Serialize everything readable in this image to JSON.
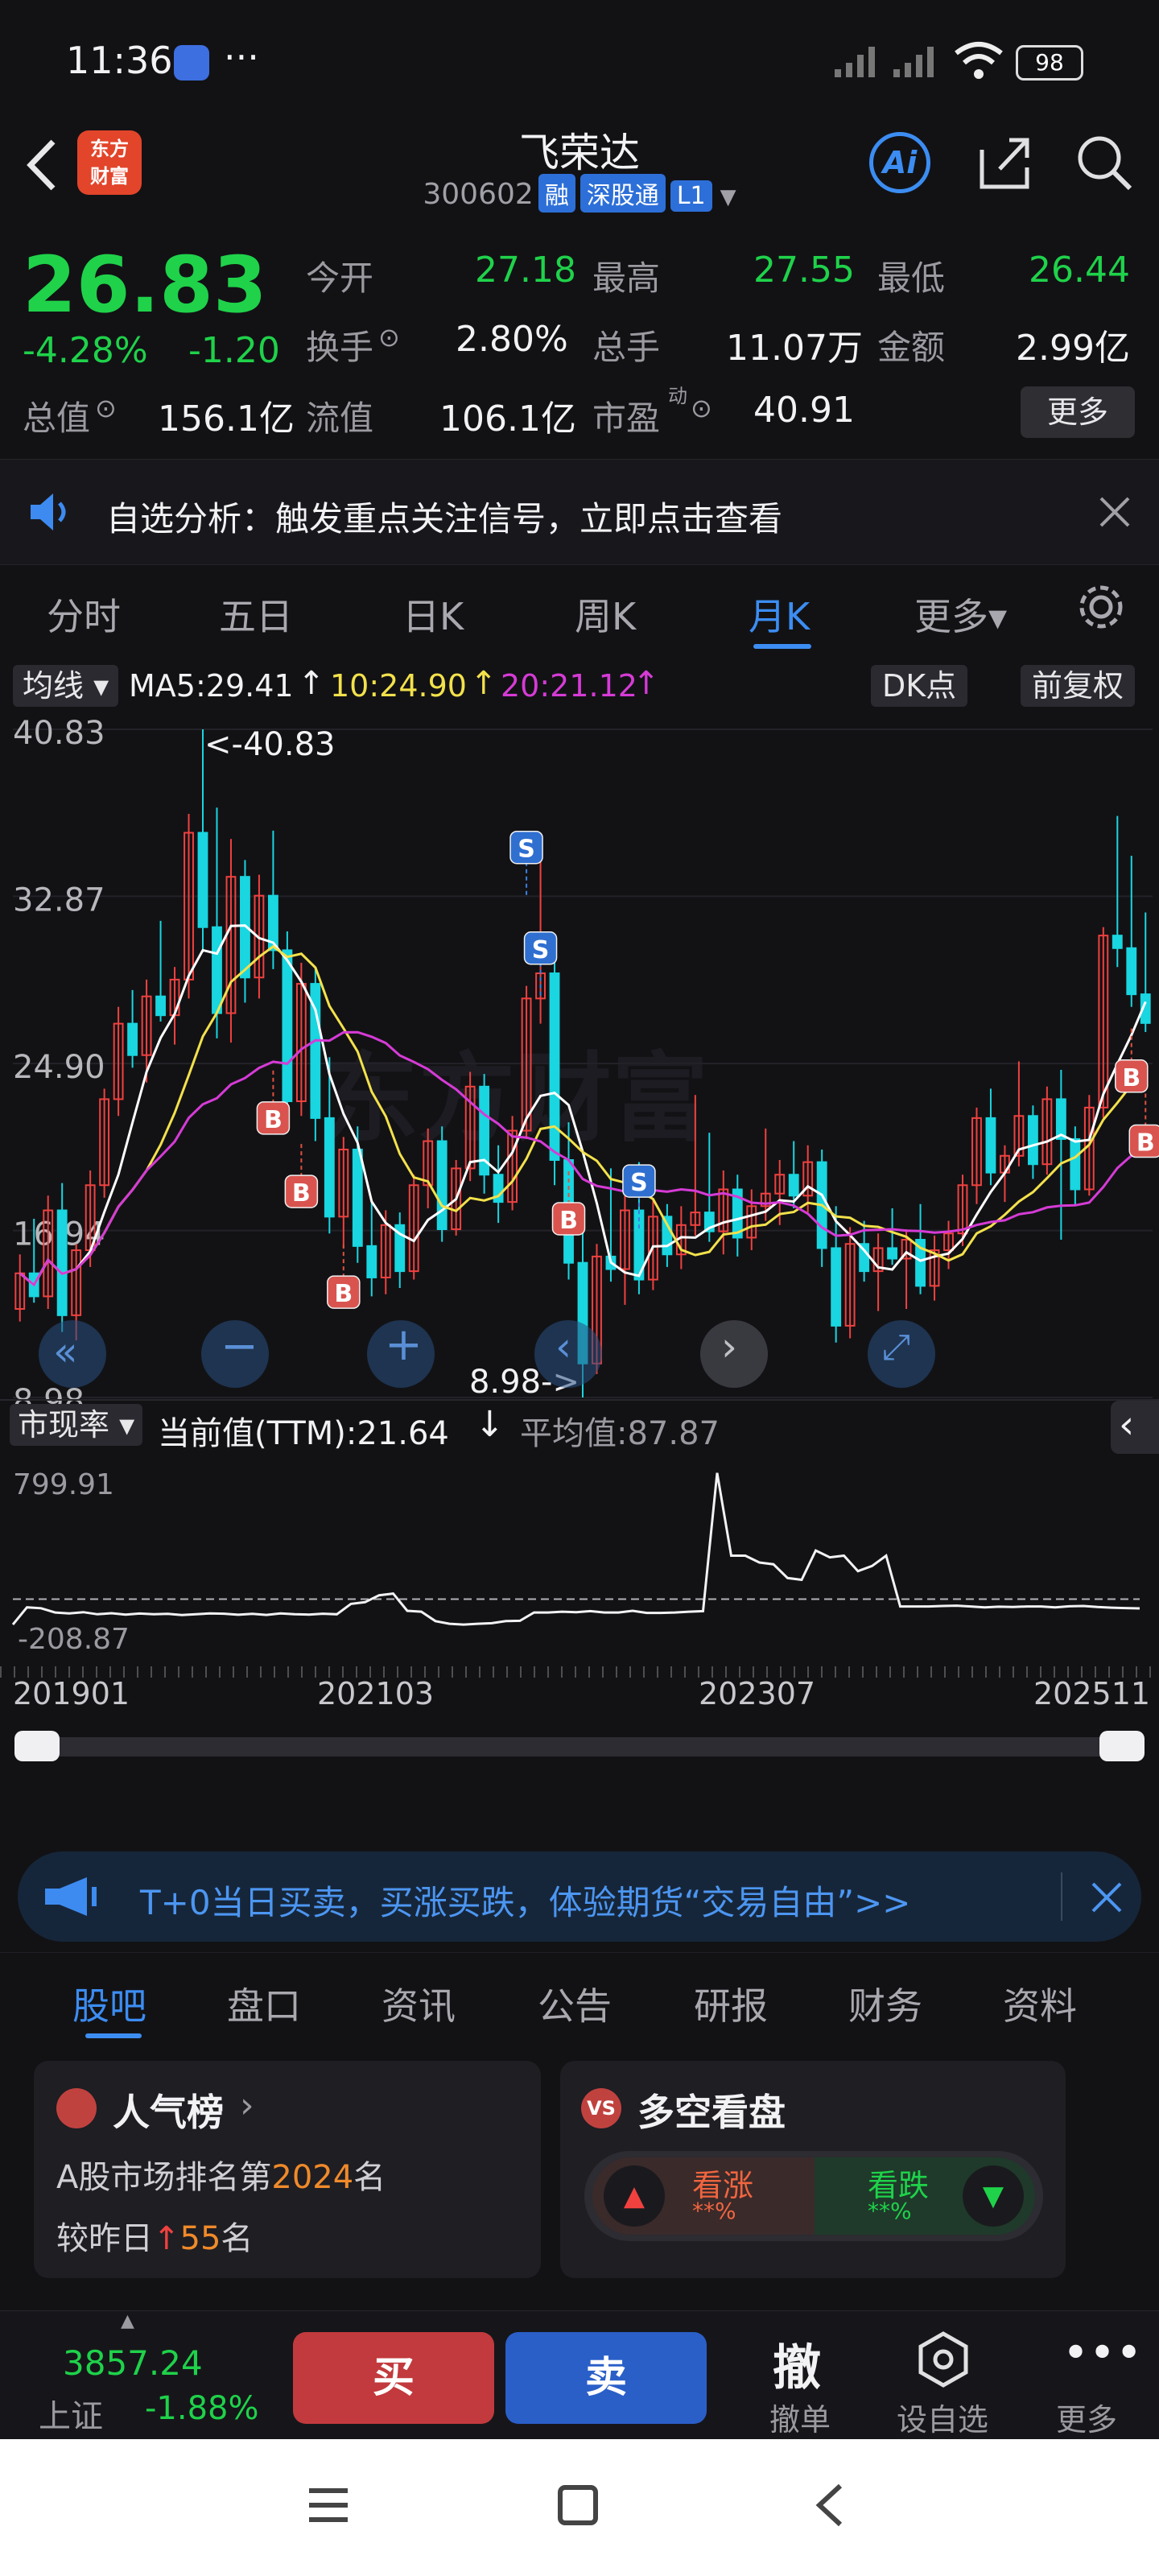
{
  "status": {
    "time": "11:36",
    "dots": "···",
    "battery": "98"
  },
  "header": {
    "logo_line1": "东方",
    "logo_line2": "财富",
    "title": "飞荣达",
    "code": "300602",
    "badge_rong": "融",
    "badge_sgt": "深股通",
    "badge_l1": "L1",
    "ai": "Ai"
  },
  "quote": {
    "price": "26.83",
    "pct": "-4.28%",
    "chg": "-1.20",
    "open_label": "今开",
    "open": "27.18",
    "high_label": "最高",
    "high": "27.55",
    "low_label": "最低",
    "low": "26.44",
    "turn_label": "换手",
    "turn": "2.80%",
    "vol_label": "总手",
    "vol": "11.07万",
    "amt_label": "金额",
    "amt": "2.99亿",
    "mcap_label": "总值",
    "mcap": "156.1亿",
    "float_label": "流值",
    "float": "106.1亿",
    "pe_label": "市盈",
    "pe_sup": "动",
    "pe": "40.91",
    "more": "更多"
  },
  "notice": {
    "text": "自选分析：触发重点关注信号，立即点击查看"
  },
  "tabs": [
    {
      "label": "分时"
    },
    {
      "label": "五日"
    },
    {
      "label": "日K"
    },
    {
      "label": "周K"
    },
    {
      "label": "月K"
    },
    {
      "label": "更多▾"
    }
  ],
  "legend": {
    "ma_type": "均线",
    "ma5": "MA5:29.41",
    "ma10": "10:24.90",
    "ma20": "20:21.12",
    "dk": "DK点",
    "fq": "前复权"
  },
  "chart_data": {
    "type": "candlestick",
    "period": "monthly",
    "x_start": "201901",
    "x_end": "202511",
    "x_ticks": [
      "201901",
      "202103",
      "202307",
      "202511"
    ],
    "y_ticks": [
      "40.83",
      "32.87",
      "24.90",
      "16.94",
      "8.98"
    ],
    "ylim": [
      8.98,
      40.83
    ],
    "max_label": "<-40.83",
    "min_label": "8.98->",
    "ma_colors": {
      "ma5": "#ffffff",
      "ma10": "#f3e14b",
      "ma20": "#d63bd6"
    },
    "candles": [
      [
        13.2,
        15.8,
        12.6,
        14.9
      ],
      [
        14.9,
        17.5,
        13.5,
        13.8
      ],
      [
        13.8,
        18.6,
        13.2,
        17.9
      ],
      [
        17.9,
        19.2,
        12.1,
        12.9
      ],
      [
        12.9,
        16.3,
        11.7,
        16.0
      ],
      [
        16.0,
        19.8,
        15.2,
        19.1
      ],
      [
        19.1,
        23.7,
        18.5,
        23.2
      ],
      [
        23.2,
        27.6,
        22.4,
        26.8
      ],
      [
        26.8,
        28.4,
        24.7,
        25.3
      ],
      [
        25.3,
        28.9,
        24.0,
        28.1
      ],
      [
        28.1,
        31.7,
        26.9,
        27.2
      ],
      [
        27.2,
        29.5,
        25.8,
        28.9
      ],
      [
        28.9,
        36.8,
        28.0,
        35.9
      ],
      [
        35.9,
        40.83,
        30.2,
        31.4
      ],
      [
        31.4,
        37.1,
        26.1,
        27.3
      ],
      [
        27.3,
        35.6,
        25.9,
        33.8
      ],
      [
        33.8,
        34.6,
        27.8,
        29.0
      ],
      [
        29.0,
        33.9,
        28.0,
        32.9
      ],
      [
        32.9,
        36.0,
        29.4,
        30.3
      ],
      [
        30.3,
        31.2,
        22.0,
        23.1
      ],
      [
        23.1,
        29.7,
        22.4,
        28.7
      ],
      [
        28.7,
        29.5,
        21.2,
        22.3
      ],
      [
        22.3,
        25.2,
        16.8,
        17.6
      ],
      [
        17.6,
        21.4,
        16.1,
        20.8
      ],
      [
        20.8,
        21.9,
        15.4,
        16.2
      ],
      [
        16.2,
        18.3,
        13.8,
        14.7
      ],
      [
        14.7,
        17.9,
        13.9,
        17.2
      ],
      [
        17.2,
        17.8,
        14.2,
        15.0
      ],
      [
        15.0,
        19.6,
        14.6,
        19.1
      ],
      [
        19.1,
        21.8,
        18.0,
        21.2
      ],
      [
        21.2,
        21.9,
        16.4,
        17.0
      ],
      [
        17.0,
        20.3,
        16.7,
        19.9
      ],
      [
        19.9,
        24.5,
        19.3,
        23.8
      ],
      [
        23.8,
        24.4,
        18.7,
        19.6
      ],
      [
        19.6,
        21.0,
        17.3,
        18.3
      ],
      [
        18.3,
        22.4,
        17.9,
        21.7
      ],
      [
        21.7,
        28.6,
        21.3,
        28.0
      ],
      [
        28.0,
        35.4,
        26.8,
        29.2
      ],
      [
        29.2,
        30.6,
        19.1,
        20.3
      ],
      [
        20.3,
        22.1,
        14.6,
        15.4
      ],
      [
        15.4,
        16.9,
        8.98,
        10.6
      ],
      [
        10.6,
        16.3,
        10.1,
        15.7
      ],
      [
        15.7,
        19.9,
        14.5,
        15.1
      ],
      [
        15.1,
        18.6,
        13.4,
        17.9
      ],
      [
        17.9,
        20.2,
        13.9,
        14.6
      ],
      [
        14.6,
        18.4,
        14.1,
        17.6
      ],
      [
        17.6,
        18.2,
        15.2,
        15.8
      ],
      [
        15.8,
        18.1,
        15.1,
        17.2
      ],
      [
        17.2,
        23.4,
        16.7,
        17.8
      ],
      [
        17.8,
        21.6,
        16.4,
        16.9
      ],
      [
        16.9,
        19.8,
        15.8,
        18.9
      ],
      [
        18.9,
        19.6,
        15.7,
        16.6
      ],
      [
        16.6,
        18.9,
        16.0,
        18.1
      ],
      [
        18.1,
        21.8,
        17.4,
        18.7
      ],
      [
        18.7,
        20.3,
        17.2,
        19.6
      ],
      [
        19.6,
        21.2,
        18.0,
        18.6
      ],
      [
        18.6,
        21.0,
        17.8,
        20.2
      ],
      [
        20.2,
        20.8,
        15.2,
        16.1
      ],
      [
        16.1,
        18.1,
        11.6,
        12.4
      ],
      [
        12.4,
        17.1,
        11.8,
        16.3
      ],
      [
        16.3,
        17.4,
        14.5,
        15.0
      ],
      [
        15.0,
        16.8,
        13.1,
        16.1
      ],
      [
        16.1,
        18.0,
        15.3,
        15.6
      ],
      [
        15.6,
        17.0,
        13.2,
        16.5
      ],
      [
        16.5,
        18.2,
        13.9,
        14.3
      ],
      [
        14.3,
        16.7,
        13.6,
        16.0
      ],
      [
        16.0,
        17.4,
        15.1,
        16.8
      ],
      [
        16.8,
        19.6,
        16.2,
        19.1
      ],
      [
        19.1,
        22.8,
        18.2,
        22.3
      ],
      [
        22.3,
        23.7,
        19.1,
        19.7
      ],
      [
        19.7,
        21.0,
        18.3,
        20.5
      ],
      [
        20.5,
        25.0,
        20.0,
        22.4
      ],
      [
        22.4,
        22.9,
        19.4,
        20.1
      ],
      [
        20.1,
        23.8,
        19.6,
        23.2
      ],
      [
        23.2,
        24.6,
        16.5,
        21.3
      ],
      [
        21.3,
        21.9,
        18.1,
        18.9
      ],
      [
        18.9,
        23.4,
        18.6,
        22.8
      ],
      [
        22.8,
        31.4,
        22.3,
        31.0
      ],
      [
        31.0,
        36.7,
        29.5,
        30.4
      ],
      [
        30.4,
        34.8,
        27.6,
        28.2
      ],
      [
        28.2,
        32.1,
        26.4,
        26.83
      ]
    ],
    "signals": [
      {
        "label": "B",
        "index": 18,
        "price": 22.3
      },
      {
        "label": "B",
        "index": 20,
        "price": 18.8
      },
      {
        "label": "B",
        "index": 23,
        "price": 14.0
      },
      {
        "label": "S",
        "index": 36,
        "price": 35.2
      },
      {
        "label": "S",
        "index": 37,
        "price": 30.4
      },
      {
        "label": "B",
        "index": 39,
        "price": 17.5
      },
      {
        "label": "S",
        "index": 44,
        "price": 19.3
      },
      {
        "label": "B",
        "index": 79,
        "price": 24.3
      },
      {
        "label": "B",
        "index": 80,
        "price": 21.2
      }
    ]
  },
  "indicator": {
    "name": "市现率",
    "current": "当前值(TTM):21.64",
    "arrow": "↓",
    "avg": "平均值:87.87",
    "ymax": "799.91",
    "ymin": "-208.87",
    "avg_value": 87.87,
    "series": [
      -60,
      40,
      35,
      10,
      5,
      12,
      0,
      6,
      -2,
      4,
      0,
      2,
      -5,
      0,
      5,
      3,
      -3,
      2,
      -4,
      5,
      0,
      -2,
      3,
      0,
      60,
      70,
      110,
      120,
      20,
      15,
      -40,
      -55,
      -60,
      -55,
      -52,
      -40,
      -38,
      10,
      10,
      15,
      12,
      18,
      10,
      10,
      20,
      8,
      8,
      10,
      15,
      18,
      820,
      340,
      340,
      300,
      290,
      210,
      200,
      370,
      330,
      340,
      250,
      280,
      340,
      45,
      45,
      45,
      48,
      50,
      45,
      40,
      44,
      42,
      45,
      45,
      40,
      46,
      48,
      42,
      38,
      36,
      34
    ]
  },
  "banner": {
    "text": "T+0当日买卖，买涨买跌，体验期货“交易自由”>>"
  },
  "bottom_tabs": [
    {
      "label": "股吧"
    },
    {
      "label": "盘口"
    },
    {
      "label": "资讯"
    },
    {
      "label": "公告"
    },
    {
      "label": "研报"
    },
    {
      "label": "财务"
    },
    {
      "label": "资料"
    }
  ],
  "card1": {
    "title": "人气榜",
    "line1_prefix": "A股市场排名第",
    "rank": "2024",
    "line1_suffix": "名",
    "line2_prefix": "较昨日",
    "change": "55",
    "line2_suffix": "名"
  },
  "card2": {
    "title": "多空看盘",
    "up_label": "看涨",
    "up_val": "**%",
    "down_label": "看跌",
    "down_val": "**%"
  },
  "bottombar": {
    "index_val": "3857.24",
    "index_name": "上证",
    "index_pct": "-1.88%",
    "buy": "买",
    "sell": "卖",
    "cancel_big": "撤",
    "cancel": "撤单",
    "set_fav": "设自选",
    "more": "更多"
  }
}
